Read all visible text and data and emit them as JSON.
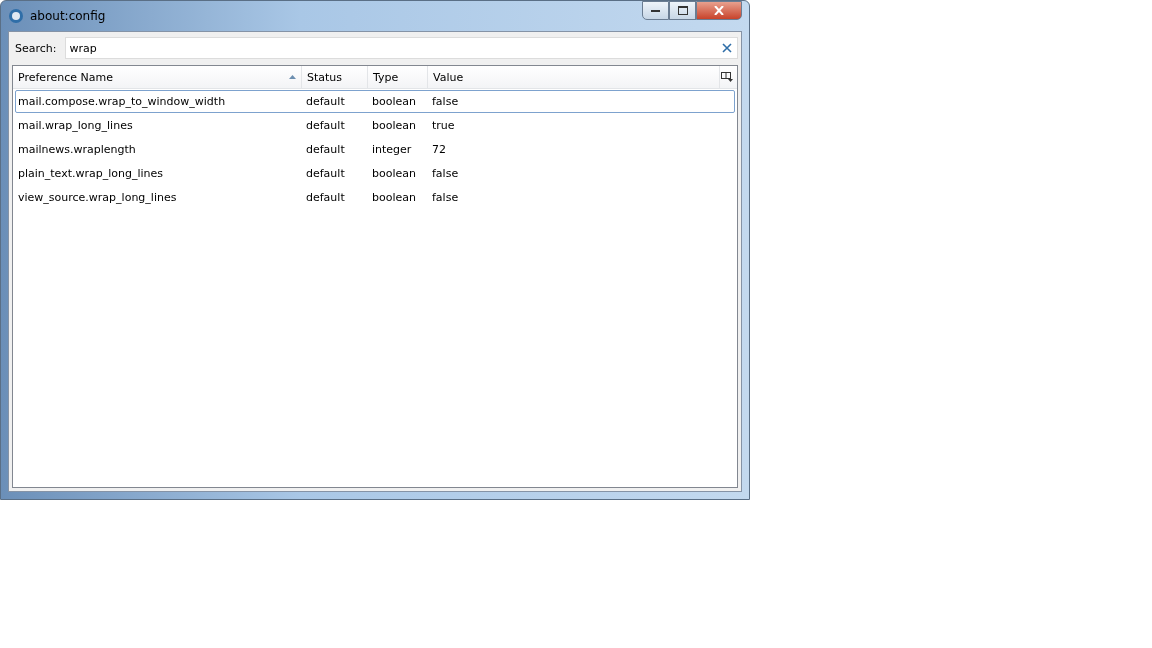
{
  "window": {
    "title": "about:config"
  },
  "search": {
    "label": "Search:",
    "value": "wrap"
  },
  "table": {
    "columns": [
      {
        "label": "Preference Name",
        "sorted": true
      },
      {
        "label": "Status",
        "sorted": false
      },
      {
        "label": "Type",
        "sorted": false
      },
      {
        "label": "Value",
        "sorted": false
      }
    ],
    "rows": [
      {
        "cells": [
          "mail.compose.wrap_to_window_width",
          "default",
          "boolean",
          "false"
        ],
        "selected": true
      },
      {
        "cells": [
          "mail.wrap_long_lines",
          "default",
          "boolean",
          "true"
        ],
        "selected": false
      },
      {
        "cells": [
          "mailnews.wraplength",
          "default",
          "integer",
          "72"
        ],
        "selected": false
      },
      {
        "cells": [
          "plain_text.wrap_long_lines",
          "default",
          "boolean",
          "false"
        ],
        "selected": false
      },
      {
        "cells": [
          "view_source.wrap_long_lines",
          "default",
          "boolean",
          "false"
        ],
        "selected": false
      }
    ]
  }
}
